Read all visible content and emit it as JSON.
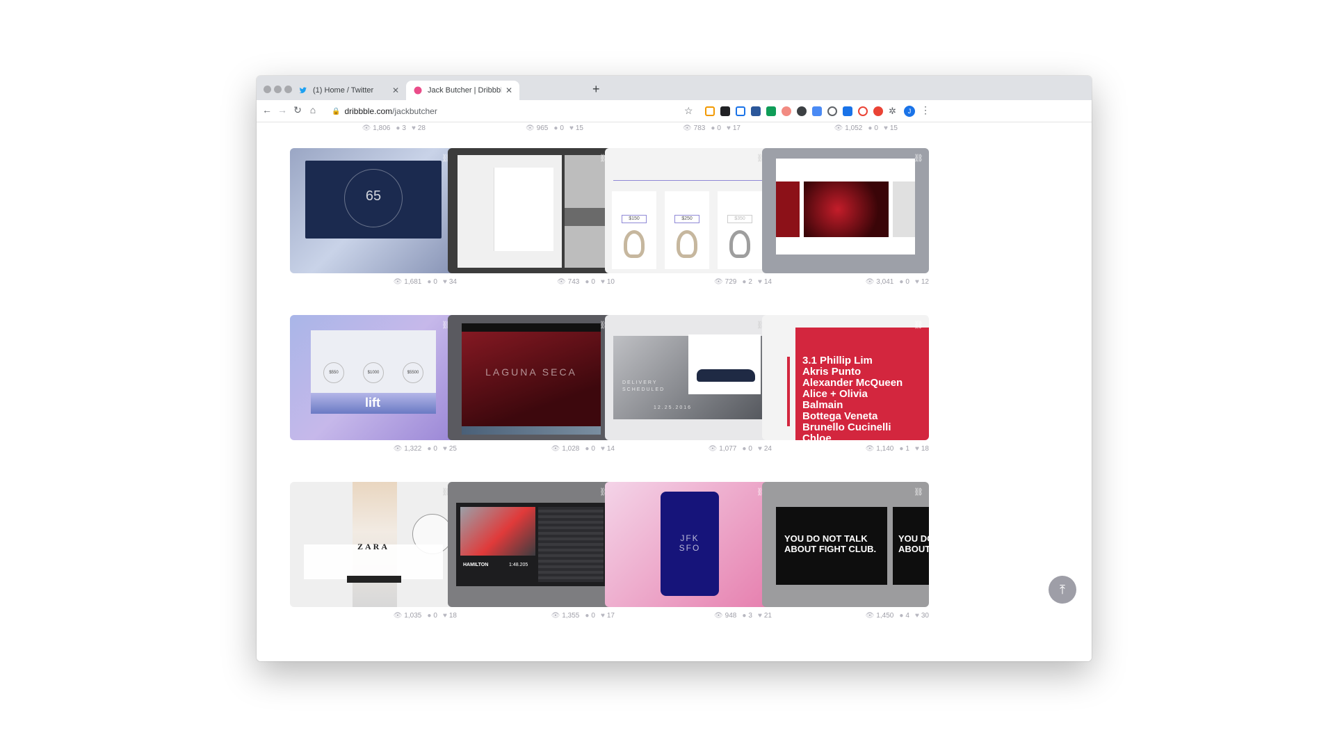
{
  "browser": {
    "tabs": [
      {
        "title": "(1) Home / Twitter",
        "active": false,
        "icon": "twitter-bird-icon"
      },
      {
        "title": "Jack Butcher | Dribbble",
        "active": true,
        "icon": "dribbble-ball-icon"
      }
    ],
    "url_host": "dribbble.com",
    "url_path": "/jackbutcher"
  },
  "top_stats": [
    {
      "views": "1,806",
      "comments": "3",
      "likes": "28"
    },
    {
      "views": "965",
      "comments": "0",
      "likes": "15"
    },
    {
      "views": "783",
      "comments": "0",
      "likes": "17"
    },
    {
      "views": "1,052",
      "comments": "0",
      "likes": "15"
    }
  ],
  "shots": [
    {
      "views": "1,681",
      "comments": "0",
      "likes": "34",
      "screen_text": "65"
    },
    {
      "views": "743",
      "comments": "0",
      "likes": "10"
    },
    {
      "views": "729",
      "comments": "2",
      "likes": "14",
      "prices": [
        "$150",
        "$250",
        "$350"
      ]
    },
    {
      "views": "3,041",
      "comments": "0",
      "likes": "12"
    },
    {
      "views": "1,322",
      "comments": "0",
      "likes": "25",
      "prices": [
        "$550",
        "$1000",
        "$5500"
      ],
      "logo": "lift"
    },
    {
      "views": "1,028",
      "comments": "0",
      "likes": "14",
      "screen_text": "LAGUNA SECA"
    },
    {
      "views": "1,077",
      "comments": "0",
      "likes": "24",
      "screen_lines": [
        "DELIVERY",
        "SCHEDULED",
        "12.25.2016"
      ]
    },
    {
      "views": "1,140",
      "comments": "1",
      "likes": "18",
      "brands": [
        "3.1 Phillip Lim",
        "Akris Punto",
        "Alexander McQueen",
        "Alice + Olivia",
        "Balmain",
        "Bottega Veneta",
        "Brunello Cucinelli",
        "Chloe"
      ]
    },
    {
      "views": "1,035",
      "comments": "0",
      "likes": "18",
      "logo": "ZARA"
    },
    {
      "views": "1,355",
      "comments": "0",
      "likes": "17",
      "screen_lines": [
        "HAMILTON",
        "1:48.205"
      ]
    },
    {
      "views": "948",
      "comments": "3",
      "likes": "21",
      "screen_lines": [
        "JFK",
        "SFO"
      ]
    },
    {
      "views": "1,450",
      "comments": "4",
      "likes": "30",
      "screen_lines": [
        "YOU DO NOT TALK",
        "ABOUT FIGHT CLUB.",
        "YOU DO",
        "ABOUT"
      ]
    }
  ]
}
